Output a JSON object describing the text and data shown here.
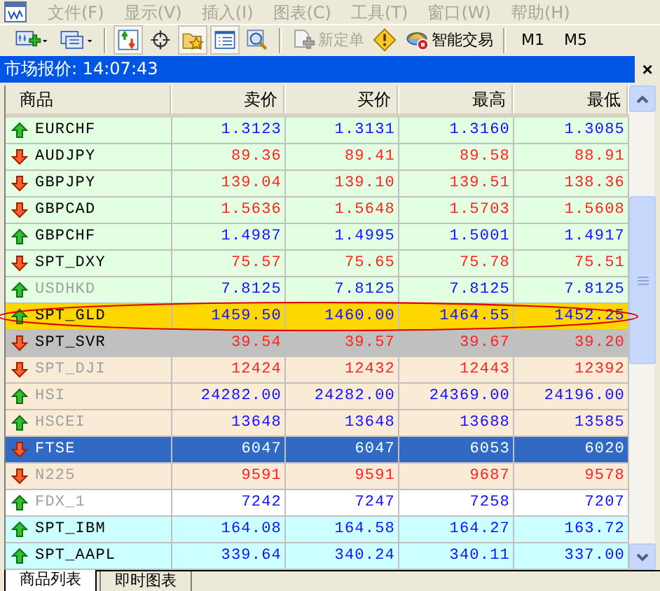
{
  "menu": [
    {
      "label": "文件(F)",
      "disabled": true
    },
    {
      "label": "显示(V)",
      "disabled": true
    },
    {
      "label": "插入(I)",
      "disabled": true
    },
    {
      "label": "图表(C)",
      "disabled": true
    },
    {
      "label": "工具(T)",
      "disabled": true
    },
    {
      "label": "窗口(W)",
      "disabled": true
    },
    {
      "label": "帮助(H)",
      "disabled": true
    }
  ],
  "toolbar": [
    {
      "kind": "new-chart"
    },
    {
      "kind": "profiles"
    },
    {
      "kind": "sep"
    },
    {
      "kind": "navigator",
      "pressed": true
    },
    {
      "kind": "crosshair",
      "pressed": false
    },
    {
      "kind": "favorites",
      "pressed": true
    },
    {
      "kind": "market-watch",
      "pressed": true
    },
    {
      "kind": "data-window",
      "pressed": false
    },
    {
      "kind": "sep"
    },
    {
      "kind": "new-order",
      "label": "新定单",
      "disabled": true
    },
    {
      "kind": "alert"
    },
    {
      "kind": "expert",
      "label": "智能交易",
      "disabled": false
    },
    {
      "kind": "sep"
    },
    {
      "kind": "period",
      "label": "M1"
    },
    {
      "kind": "period",
      "label": "M5"
    }
  ],
  "panel": {
    "title": "市场报价: 14:07:43",
    "close": "×"
  },
  "columns": [
    "商品",
    "卖价",
    "买价",
    "最高",
    "最低"
  ],
  "rows": [
    {
      "symbol": "EURCHF",
      "trend_up": true,
      "dimmed": false,
      "color": "#e2ffe2",
      "selected": false,
      "circled": false,
      "bid": "1.3123",
      "ask": "1.3131",
      "high": "1.3160",
      "low": "1.3085"
    },
    {
      "symbol": "AUDJPY",
      "trend_up": false,
      "dimmed": false,
      "color": "#e2ffe2",
      "selected": false,
      "circled": false,
      "bid": "89.36",
      "ask": "89.41",
      "high": "89.58",
      "low": "88.91"
    },
    {
      "symbol": "GBPJPY",
      "trend_up": false,
      "dimmed": false,
      "color": "#e2ffe2",
      "selected": false,
      "circled": false,
      "bid": "139.04",
      "ask": "139.10",
      "high": "139.51",
      "low": "138.36"
    },
    {
      "symbol": "GBPCAD",
      "trend_up": false,
      "dimmed": false,
      "color": "#e2ffe2",
      "selected": false,
      "circled": false,
      "bid": "1.5636",
      "ask": "1.5648",
      "high": "1.5703",
      "low": "1.5608"
    },
    {
      "symbol": "GBPCHF",
      "trend_up": true,
      "dimmed": false,
      "color": "#e2ffe2",
      "selected": false,
      "circled": false,
      "bid": "1.4987",
      "ask": "1.4995",
      "high": "1.5001",
      "low": "1.4917"
    },
    {
      "symbol": "SPT_DXY",
      "trend_up": false,
      "dimmed": false,
      "color": "#e2ffe2",
      "selected": false,
      "circled": false,
      "bid": "75.57",
      "ask": "75.65",
      "high": "75.78",
      "low": "75.51"
    },
    {
      "symbol": "USDHKD",
      "trend_up": true,
      "dimmed": true,
      "color": "#e2ffe2",
      "selected": false,
      "circled": false,
      "bid": "7.8125",
      "ask": "7.8125",
      "high": "7.8125",
      "low": "7.8125"
    },
    {
      "symbol": "SPT_GLD",
      "trend_up": true,
      "dimmed": false,
      "color": "#ffd700",
      "selected": false,
      "circled": true,
      "bid": "1459.50",
      "ask": "1460.00",
      "high": "1464.55",
      "low": "1452.25"
    },
    {
      "symbol": "SPT_SVR",
      "trend_up": false,
      "dimmed": false,
      "color": "#c0c0c0",
      "selected": false,
      "circled": false,
      "bid": "39.54",
      "ask": "39.57",
      "high": "39.67",
      "low": "39.20"
    },
    {
      "symbol": "SPT_DJI",
      "trend_up": false,
      "dimmed": true,
      "color": "#faebd7",
      "selected": false,
      "circled": false,
      "bid": "12424",
      "ask": "12432",
      "high": "12443",
      "low": "12392"
    },
    {
      "symbol": "HSI",
      "trend_up": true,
      "dimmed": true,
      "color": "#faebd7",
      "selected": false,
      "circled": false,
      "bid": "24282.00",
      "ask": "24282.00",
      "high": "24369.00",
      "low": "24196.00"
    },
    {
      "symbol": "HSCEI",
      "trend_up": true,
      "dimmed": true,
      "color": "#faebd7",
      "selected": false,
      "circled": false,
      "bid": "13648",
      "ask": "13648",
      "high": "13688",
      "low": "13585"
    },
    {
      "symbol": "FTSE",
      "trend_up": false,
      "dimmed": false,
      "selected": true,
      "circled": false,
      "bid": "6047",
      "ask": "6047",
      "high": "6053",
      "low": "6020"
    },
    {
      "symbol": "N225",
      "trend_up": false,
      "dimmed": true,
      "color": "#faebd7",
      "selected": false,
      "circled": false,
      "bid": "9591",
      "ask": "9591",
      "high": "9687",
      "low": "9578"
    },
    {
      "symbol": "FDX_1",
      "trend_up": true,
      "dimmed": true,
      "color": "#ffffff",
      "selected": false,
      "circled": false,
      "bid": "7242",
      "ask": "7247",
      "high": "7258",
      "low": "7207"
    },
    {
      "symbol": "SPT_IBM",
      "trend_up": true,
      "dimmed": false,
      "color": "#ccffff",
      "selected": false,
      "circled": false,
      "bid": "164.08",
      "ask": "164.58",
      "high": "164.27",
      "low": "163.72"
    },
    {
      "symbol": "SPT_AAPL",
      "trend_up": true,
      "dimmed": false,
      "color": "#ccffff",
      "selected": false,
      "circled": false,
      "bid": "339.64",
      "ask": "340.24",
      "high": "340.11",
      "low": "337.00"
    }
  ],
  "tabs": [
    {
      "label": "商品列表",
      "selected": true
    },
    {
      "label": "即时图表",
      "selected": false
    }
  ]
}
